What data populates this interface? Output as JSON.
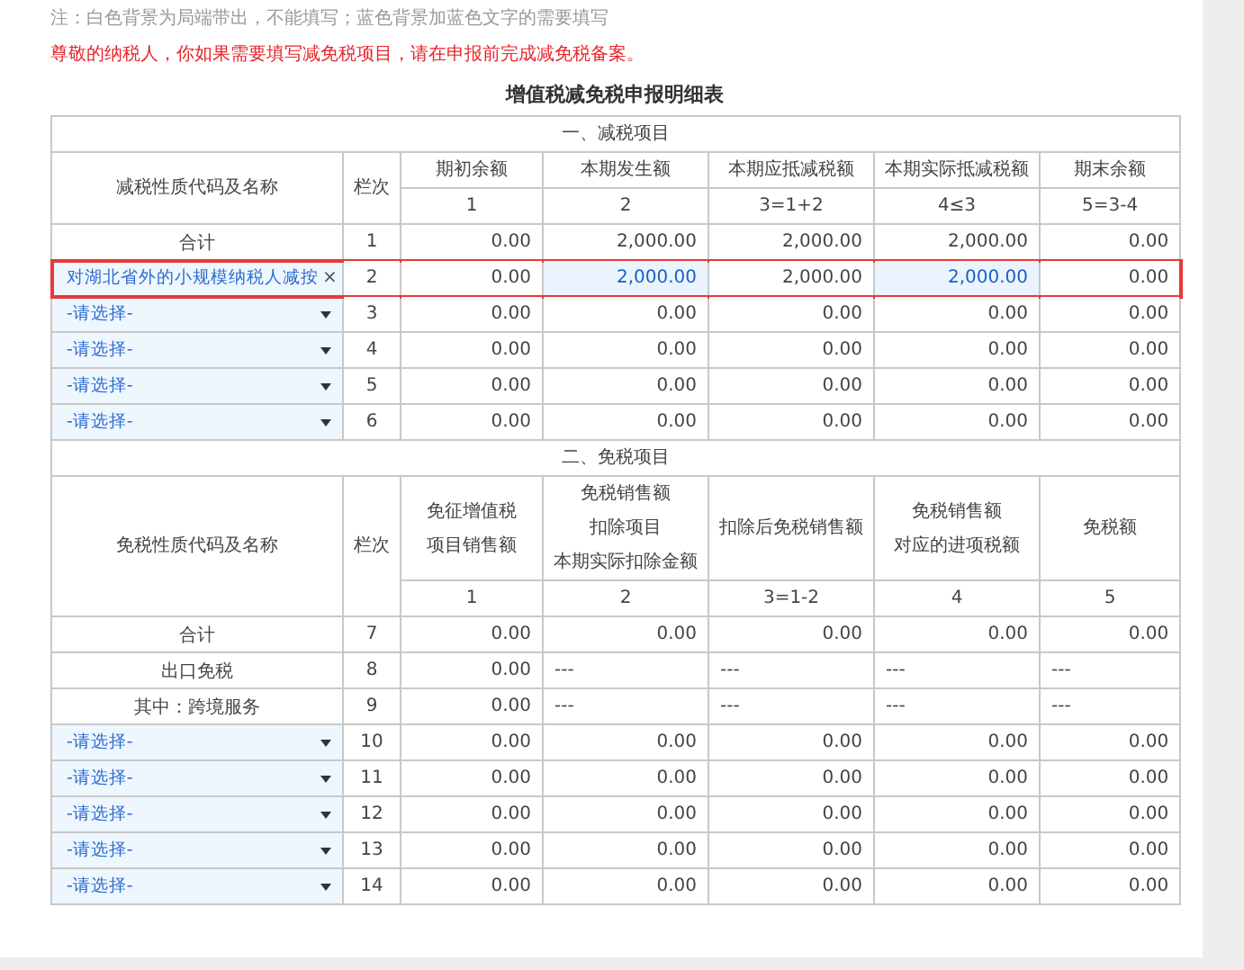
{
  "note": "注：白色背景为局端带出，不能填写；蓝色背景加蓝色文字的需要填写",
  "warning": "尊敬的纳税人，你如果需要填写减免税项目，请在申报前完成减免税备案。",
  "title": "增值税减免税申报明细表",
  "sections": [
    {
      "heading": "一、减税项目",
      "name_header": "减税性质代码及名称",
      "index_header": "栏次",
      "columns": [
        {
          "label": [
            "期初余额"
          ],
          "formula": "1"
        },
        {
          "label": [
            "本期发生额"
          ],
          "formula": "2"
        },
        {
          "label": [
            "本期应抵减税额"
          ],
          "formula": "3=1+2"
        },
        {
          "label": [
            "本期实际抵减税额"
          ],
          "formula": "4≤3"
        },
        {
          "label": [
            "期末余额"
          ],
          "formula": "5=3-4"
        }
      ],
      "rows": [
        {
          "kind": "label",
          "name": "合计",
          "index": "1",
          "cells": [
            {
              "value": "0.00",
              "editable": false
            },
            {
              "value": "2,000.00",
              "editable": false
            },
            {
              "value": "2,000.00",
              "editable": false
            },
            {
              "value": "2,000.00",
              "editable": false
            },
            {
              "value": "0.00",
              "editable": false
            }
          ]
        },
        {
          "kind": "select",
          "name": "对湖北省外的小规模纳税人减按",
          "clear": "×",
          "index": "2",
          "highlighted": true,
          "cells": [
            {
              "value": "0.00",
              "editable": false
            },
            {
              "value": "2,000.00",
              "editable": true
            },
            {
              "value": "2,000.00",
              "editable": false
            },
            {
              "value": "2,000.00",
              "editable": true
            },
            {
              "value": "0.00",
              "editable": false
            }
          ]
        },
        {
          "kind": "select",
          "name": "-请选择-",
          "index": "3",
          "cells": [
            {
              "value": "0.00",
              "editable": false
            },
            {
              "value": "0.00",
              "editable": false
            },
            {
              "value": "0.00",
              "editable": false
            },
            {
              "value": "0.00",
              "editable": false
            },
            {
              "value": "0.00",
              "editable": false
            }
          ]
        },
        {
          "kind": "select",
          "name": "-请选择-",
          "index": "4",
          "cells": [
            {
              "value": "0.00",
              "editable": false
            },
            {
              "value": "0.00",
              "editable": false
            },
            {
              "value": "0.00",
              "editable": false
            },
            {
              "value": "0.00",
              "editable": false
            },
            {
              "value": "0.00",
              "editable": false
            }
          ]
        },
        {
          "kind": "select",
          "name": "-请选择-",
          "index": "5",
          "cells": [
            {
              "value": "0.00",
              "editable": false
            },
            {
              "value": "0.00",
              "editable": false
            },
            {
              "value": "0.00",
              "editable": false
            },
            {
              "value": "0.00",
              "editable": false
            },
            {
              "value": "0.00",
              "editable": false
            }
          ]
        },
        {
          "kind": "select",
          "name": "-请选择-",
          "index": "6",
          "cells": [
            {
              "value": "0.00",
              "editable": false
            },
            {
              "value": "0.00",
              "editable": false
            },
            {
              "value": "0.00",
              "editable": false
            },
            {
              "value": "0.00",
              "editable": false
            },
            {
              "value": "0.00",
              "editable": false
            }
          ]
        }
      ]
    },
    {
      "heading": "二、免税项目",
      "name_header": "免税性质代码及名称",
      "index_header": "栏次",
      "columns": [
        {
          "label": [
            "免征增值税",
            "项目销售额"
          ],
          "formula": "1"
        },
        {
          "label": [
            "免税销售额",
            "扣除项目",
            "本期实际扣除金额"
          ],
          "formula": "2"
        },
        {
          "label": [
            "扣除后免税销售额"
          ],
          "formula": "3=1-2"
        },
        {
          "label": [
            "免税销售额",
            "对应的进项税额"
          ],
          "formula": "4"
        },
        {
          "label": [
            "免税额"
          ],
          "formula": "5"
        }
      ],
      "rows": [
        {
          "kind": "label",
          "name": "合计",
          "index": "7",
          "cells": [
            {
              "value": "0.00",
              "editable": false
            },
            {
              "value": "0.00",
              "editable": false
            },
            {
              "value": "0.00",
              "editable": false
            },
            {
              "value": "0.00",
              "editable": false
            },
            {
              "value": "0.00",
              "editable": false
            }
          ]
        },
        {
          "kind": "label",
          "name": "出口免税",
          "index": "8",
          "cells": [
            {
              "value": "0.00",
              "editable": false
            },
            {
              "value": "---",
              "editable": false
            },
            {
              "value": "---",
              "editable": false
            },
            {
              "value": "---",
              "editable": false
            },
            {
              "value": "---",
              "editable": false
            }
          ]
        },
        {
          "kind": "label",
          "name": "其中：跨境服务",
          "index": "9",
          "cells": [
            {
              "value": "0.00",
              "editable": false
            },
            {
              "value": "---",
              "editable": false
            },
            {
              "value": "---",
              "editable": false
            },
            {
              "value": "---",
              "editable": false
            },
            {
              "value": "---",
              "editable": false
            }
          ]
        },
        {
          "kind": "select",
          "name": "-请选择-",
          "index": "10",
          "cells": [
            {
              "value": "0.00",
              "editable": false
            },
            {
              "value": "0.00",
              "editable": false
            },
            {
              "value": "0.00",
              "editable": false
            },
            {
              "value": "0.00",
              "editable": false
            },
            {
              "value": "0.00",
              "editable": false
            }
          ]
        },
        {
          "kind": "select",
          "name": "-请选择-",
          "index": "11",
          "cells": [
            {
              "value": "0.00",
              "editable": false
            },
            {
              "value": "0.00",
              "editable": false
            },
            {
              "value": "0.00",
              "editable": false
            },
            {
              "value": "0.00",
              "editable": false
            },
            {
              "value": "0.00",
              "editable": false
            }
          ]
        },
        {
          "kind": "select",
          "name": "-请选择-",
          "index": "12",
          "cells": [
            {
              "value": "0.00",
              "editable": false
            },
            {
              "value": "0.00",
              "editable": false
            },
            {
              "value": "0.00",
              "editable": false
            },
            {
              "value": "0.00",
              "editable": false
            },
            {
              "value": "0.00",
              "editable": false
            }
          ]
        },
        {
          "kind": "select",
          "name": "-请选择-",
          "index": "13",
          "cells": [
            {
              "value": "0.00",
              "editable": false
            },
            {
              "value": "0.00",
              "editable": false
            },
            {
              "value": "0.00",
              "editable": false
            },
            {
              "value": "0.00",
              "editable": false
            },
            {
              "value": "0.00",
              "editable": false
            }
          ]
        },
        {
          "kind": "select",
          "name": "-请选择-",
          "index": "14",
          "cells": [
            {
              "value": "0.00",
              "editable": false
            },
            {
              "value": "0.00",
              "editable": false
            },
            {
              "value": "0.00",
              "editable": false
            },
            {
              "value": "0.00",
              "editable": false
            },
            {
              "value": "0.00",
              "editable": false
            }
          ]
        }
      ]
    }
  ]
}
